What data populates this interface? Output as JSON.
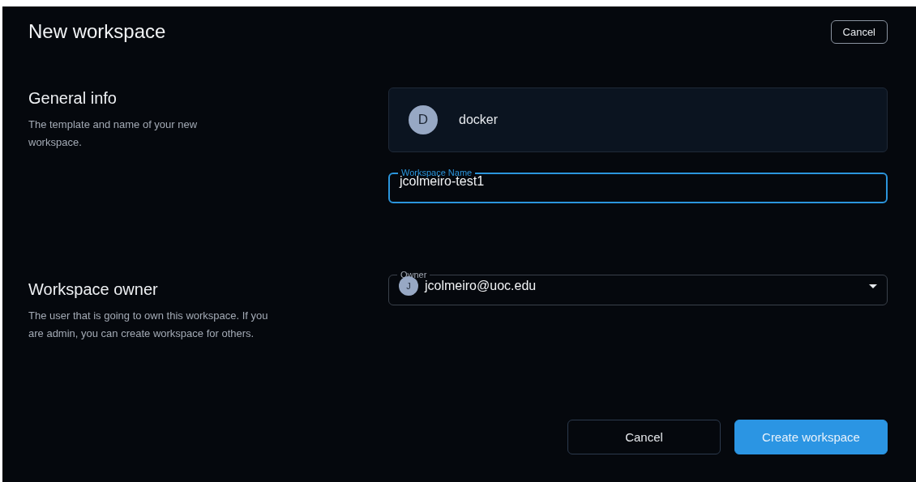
{
  "header": {
    "title": "New workspace",
    "cancel_button": "Cancel"
  },
  "sections": [
    {
      "heading": "General info",
      "description": "The template and name of your new workspace.",
      "kind": "template"
    },
    {
      "heading": "Workspace owner",
      "description": "The user that is going to own this workspace. If you are admin, you can create workspace for others.",
      "kind": "owner"
    }
  ],
  "template": {
    "avatar": "D",
    "name": "docker"
  },
  "name_field": {
    "label": "Workspace Name",
    "value": "jcolmeiro-test1",
    "focused": true
  },
  "owner_field": {
    "label": "Owner",
    "avatar": "J",
    "value": "jcolmeiro@uoc.edu"
  },
  "footer": {
    "buttons": [
      {
        "label": "Cancel",
        "kind": "secondary"
      },
      {
        "label": "Create workspace",
        "kind": "primary"
      }
    ]
  }
}
